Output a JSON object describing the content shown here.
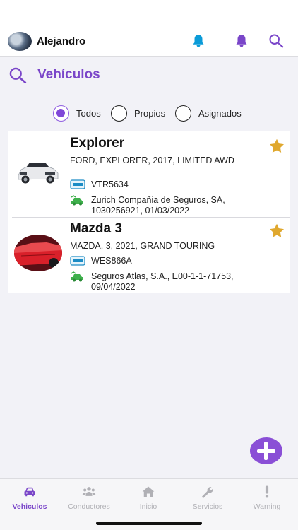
{
  "header": {
    "username": "Alejandro",
    "icons": [
      "avatar",
      "bell-icon",
      "bell-icon",
      "search-icon"
    ],
    "accent_color": "#7a46c9",
    "notification_color": "#0a9bd8"
  },
  "section": {
    "title": "Vehículos",
    "icon": "search-icon"
  },
  "filters": {
    "options": [
      "Todos",
      "Propios",
      "Asignados"
    ],
    "selected": "Todos"
  },
  "vehicles": [
    {
      "name": "Explorer",
      "description": "FORD, EXPLORER, 2017, LIMITED AWD",
      "plate": "VTR5634",
      "insurance": "Zurich Compañia de Seguros, SA, 1030256921, 01/03/2022",
      "favorite": true
    },
    {
      "name": "Mazda 3",
      "description": "MAZDA, 3, 2021, GRAND TOURING",
      "plate": "WES866A",
      "insurance": "Seguros Atlas, S.A., E00-1-1-71753, 09/04/2022",
      "favorite": true
    }
  ],
  "tabs": [
    {
      "label": "Vehiculos",
      "icon": "car-icon",
      "active": true
    },
    {
      "label": "Conductores",
      "icon": "users-icon",
      "active": false
    },
    {
      "label": "Inicio",
      "icon": "home-icon",
      "active": false
    },
    {
      "label": "Servicios",
      "icon": "wrench-icon",
      "active": false
    },
    {
      "label": "Warning",
      "icon": "exclamation-icon",
      "active": false
    }
  ]
}
